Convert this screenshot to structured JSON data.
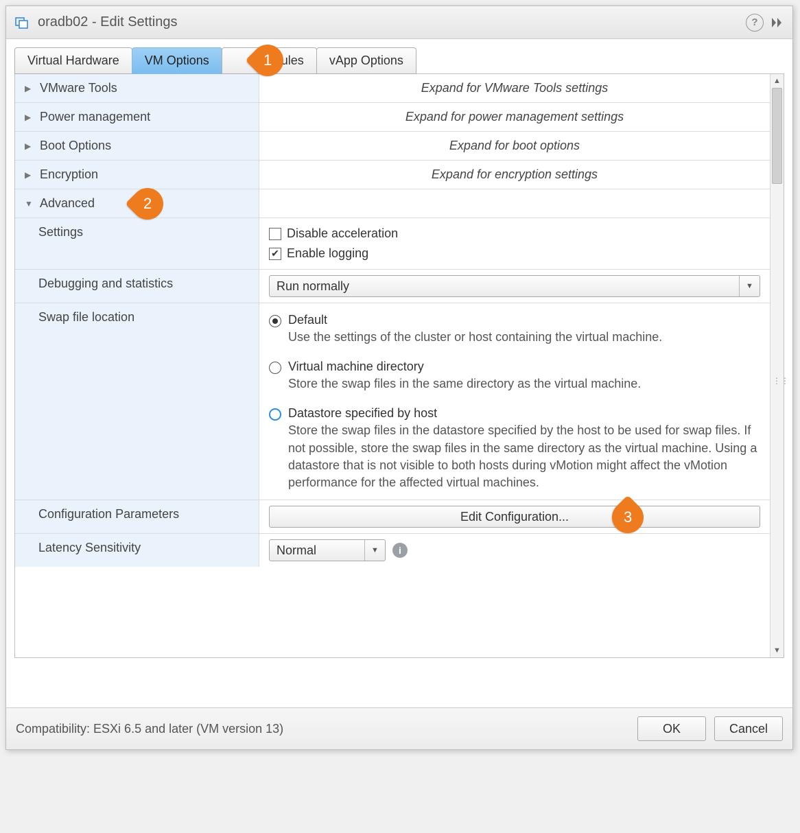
{
  "title": "oradb02 - Edit Settings",
  "tabs": {
    "virtual_hardware": "Virtual Hardware",
    "vm_options": "VM Options",
    "sdrs_rules": "S Rules",
    "vapp_options": "vApp Options"
  },
  "callouts": {
    "one": "1",
    "two": "2",
    "three": "3"
  },
  "sections": {
    "vmware_tools": {
      "label": "VMware Tools",
      "hint": "Expand for VMware Tools settings"
    },
    "power_mgmt": {
      "label": "Power management",
      "hint": "Expand for power management settings"
    },
    "boot_options": {
      "label": "Boot Options",
      "hint": "Expand for boot options"
    },
    "encryption": {
      "label": "Encryption",
      "hint": "Expand for encryption settings"
    },
    "advanced": {
      "label": "Advanced"
    }
  },
  "advanced": {
    "settings_label": "Settings",
    "disable_acceleration": "Disable acceleration",
    "enable_logging": "Enable logging",
    "debugging_label": "Debugging and statistics",
    "debugging_value": "Run normally",
    "swap_label": "Swap file location",
    "swap_opts": {
      "default_title": "Default",
      "default_desc": "Use the settings of the cluster or host containing the virtual machine.",
      "vmdir_title": "Virtual machine directory",
      "vmdir_desc": "Store the swap files in the same directory as the virtual machine.",
      "host_title": "Datastore specified by host",
      "host_desc": "Store the swap files in the datastore specified by the host to be used for swap files. If not possible, store the swap files in the same directory as the virtual machine. Using a datastore that is not visible to both hosts during vMotion might affect the vMotion performance for the affected virtual machines."
    },
    "config_params_label": "Configuration Parameters",
    "edit_config_btn": "Edit Configuration...",
    "latency_label": "Latency Sensitivity",
    "latency_value": "Normal"
  },
  "footer": {
    "compat": "Compatibility: ESXi 6.5 and later (VM version 13)",
    "ok": "OK",
    "cancel": "Cancel"
  }
}
